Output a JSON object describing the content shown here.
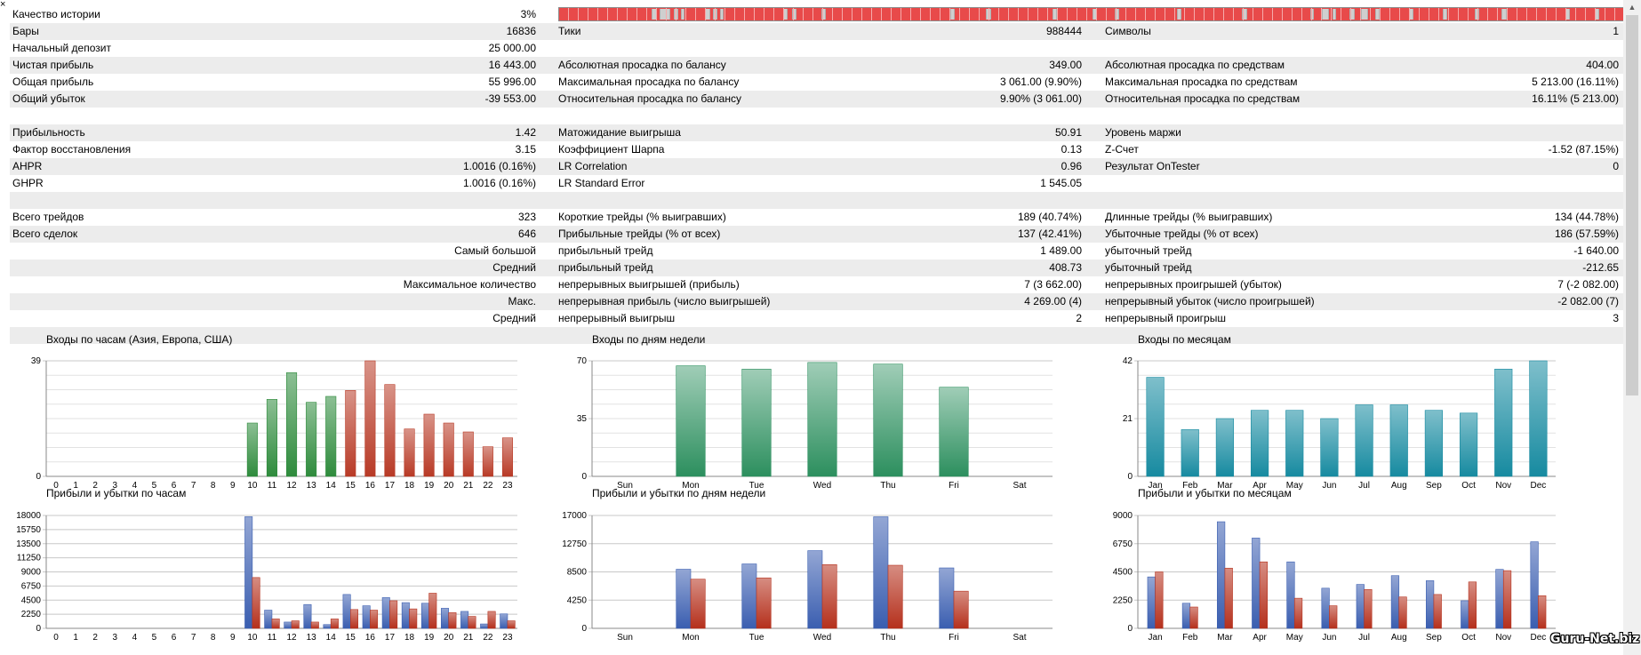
{
  "window": {
    "close_glyph": "×"
  },
  "history_quality": {
    "label": "Качество истории",
    "value": "3%"
  },
  "rows": [
    {
      "alt": true,
      "c1l": "Бары",
      "c1v": "16836",
      "c2l": "Тики",
      "c2v": "988444",
      "c3l": "Символы",
      "c3v": "1"
    },
    {
      "alt": false,
      "c1l": "Начальный депозит",
      "c1v": "25 000.00",
      "c2l": "",
      "c2v": "",
      "c3l": "",
      "c3v": ""
    },
    {
      "alt": true,
      "c1l": "Чистая прибыль",
      "c1v": "16 443.00",
      "c2l": "Абсолютная просадка по балансу",
      "c2v": "349.00",
      "c3l": "Абсолютная просадка по средствам",
      "c3v": "404.00"
    },
    {
      "alt": false,
      "c1l": "Общая прибыль",
      "c1v": "55 996.00",
      "c2l": "Максимальная просадка по балансу",
      "c2v": "3 061.00 (9.90%)",
      "c3l": "Максимальная просадка по средствам",
      "c3v": "5 213.00 (16.11%)"
    },
    {
      "alt": true,
      "c1l": "Общий убыток",
      "c1v": "-39 553.00",
      "c2l": "Относительная просадка по балансу",
      "c2v": "9.90% (3 061.00)",
      "c3l": "Относительная просадка по средствам",
      "c3v": "16.11% (5 213.00)"
    },
    {
      "alt": false,
      "c1l": "",
      "c1v": "",
      "c2l": "",
      "c2v": "",
      "c3l": "",
      "c3v": ""
    },
    {
      "alt": true,
      "c1l": "Прибыльность",
      "c1v": "1.42",
      "c2l": "Матожидание выигрыша",
      "c2v": "50.91",
      "c3l": "Уровень маржи",
      "c3v": ""
    },
    {
      "alt": false,
      "c1l": "Фактор восстановления",
      "c1v": "3.15",
      "c2l": "Коэффициент Шарпа",
      "c2v": "0.13",
      "c3l": "Z-Счет",
      "c3v": "-1.52 (87.15%)"
    },
    {
      "alt": true,
      "c1l": "AHPR",
      "c1v": "1.0016 (0.16%)",
      "c2l": "LR Correlation",
      "c2v": "0.96",
      "c3l": "Результат OnTester",
      "c3v": "0"
    },
    {
      "alt": false,
      "c1l": "GHPR",
      "c1v": "1.0016 (0.16%)",
      "c2l": "LR Standard Error",
      "c2v": "1 545.05",
      "c3l": "",
      "c3v": ""
    },
    {
      "alt": true,
      "c1l": "",
      "c1v": "",
      "c2l": "",
      "c2v": "",
      "c3l": "",
      "c3v": ""
    },
    {
      "alt": false,
      "c1l": "Всего трейдов",
      "c1v": "323",
      "c2l": "Короткие трейды (% выигравших)",
      "c2v": "189 (40.74%)",
      "c3l": "Длинные трейды (% выигравших)",
      "c3v": "134 (44.78%)"
    },
    {
      "alt": true,
      "c1l": "Всего сделок",
      "c1v": "646",
      "c2l": "Прибыльные трейды (% от всех)",
      "c2v": "137 (42.41%)",
      "c3l": "Убыточные трейды (% от всех)",
      "c3v": "186 (57.59%)"
    },
    {
      "alt": false,
      "c1r": "Самый большой",
      "c2l": "прибыльный трейд",
      "c2v": "1 489.00",
      "c3l": "убыточный трейд",
      "c3v": "-1 640.00"
    },
    {
      "alt": true,
      "c1r": "Средний",
      "c2l": "прибыльный трейд",
      "c2v": "408.73",
      "c3l": "убыточный трейд",
      "c3v": "-212.65"
    },
    {
      "alt": false,
      "c1r": "Максимальное количество",
      "c2l": "непрерывных выигрышей (прибыль)",
      "c2v": "7 (3 662.00)",
      "c3l": "непрерывных проигрышей (убыток)",
      "c3v": "7 (-2 082.00)"
    },
    {
      "alt": true,
      "c1r": "Макс.",
      "c2l": "непрерывная прибыль (число выигрышей)",
      "c2v": "4 269.00 (4)",
      "c3l": "непрерывный убыток (число проигрышей)",
      "c3v": "-2 082.00 (7)"
    },
    {
      "alt": false,
      "c1r": "Средний",
      "c2l": "непрерывный выигрыш",
      "c2v": "2",
      "c3l": "непрерывный проигрыш",
      "c3v": "3"
    },
    {
      "alt": true,
      "c1l": "",
      "c1v": "",
      "c2l": "",
      "c2v": "",
      "c3l": "",
      "c3v": ""
    }
  ],
  "colors": {
    "hours_green": "#2e8b3c",
    "hours_red": "#b83a26",
    "weekdays_green": "#2c8f5e",
    "months_teal": "#168aa0",
    "profit_blue": "#3a5eb0",
    "loss_red": "#b5301c",
    "grid": "#c8c8c8",
    "quality_red": "#e84a4a"
  },
  "watermark": "Guru-Net.biz",
  "chart_data": [
    {
      "id": "entries-hours",
      "type": "bar",
      "title": "Входы по часам (Азия, Европа, США)",
      "categories": [
        "0",
        "1",
        "2",
        "3",
        "4",
        "5",
        "6",
        "7",
        "8",
        "9",
        "10",
        "11",
        "12",
        "13",
        "14",
        "15",
        "16",
        "17",
        "18",
        "19",
        "20",
        "21",
        "22",
        "23"
      ],
      "values": [
        0,
        0,
        0,
        0,
        0,
        0,
        0,
        0,
        0,
        0,
        18,
        26,
        35,
        25,
        27,
        29,
        39,
        31,
        16,
        21,
        18,
        15,
        10,
        13
      ],
      "ylim": [
        0,
        39
      ],
      "yticks": [
        "0",
        "39"
      ],
      "grid": true
    },
    {
      "id": "entries-weekdays",
      "type": "bar",
      "title": "Входы по дням недели",
      "categories": [
        "Sun",
        "Mon",
        "Tue",
        "Wed",
        "Thu",
        "Fri",
        "Sat"
      ],
      "values": [
        0,
        67,
        65,
        69,
        68,
        54,
        0
      ],
      "ylim": [
        0,
        70
      ],
      "yticks": [
        "0",
        "35",
        "70"
      ],
      "grid": true
    },
    {
      "id": "entries-months",
      "type": "bar",
      "title": "Входы по месяцам",
      "categories": [
        "Jan",
        "Feb",
        "Mar",
        "Apr",
        "May",
        "Jun",
        "Jul",
        "Aug",
        "Sep",
        "Oct",
        "Nov",
        "Dec"
      ],
      "values": [
        36,
        17,
        21,
        24,
        24,
        21,
        26,
        26,
        24,
        23,
        39,
        42
      ],
      "ylim": [
        0,
        42
      ],
      "yticks": [
        "0",
        "21",
        "42"
      ],
      "grid": true
    },
    {
      "id": "pl-hours",
      "type": "bar",
      "title": "Прибыли и убытки по часам",
      "categories": [
        "0",
        "1",
        "2",
        "3",
        "4",
        "5",
        "6",
        "7",
        "8",
        "9",
        "10",
        "11",
        "12",
        "13",
        "14",
        "15",
        "16",
        "17",
        "18",
        "19",
        "20",
        "21",
        "22",
        "23"
      ],
      "series": [
        {
          "values": [
            0,
            0,
            0,
            0,
            0,
            0,
            0,
            0,
            0,
            0,
            17800,
            2900,
            1000,
            3800,
            600,
            5400,
            3600,
            4900,
            4100,
            4000,
            3200,
            2700,
            700,
            2300
          ]
        },
        {
          "values": [
            0,
            0,
            0,
            0,
            0,
            0,
            0,
            0,
            0,
            0,
            8100,
            1500,
            1200,
            1000,
            1500,
            3000,
            2900,
            4400,
            3100,
            5600,
            2500,
            1900,
            2700,
            1200
          ]
        }
      ],
      "ylim": [
        0,
        18000
      ],
      "yticks": [
        "0",
        "2250",
        "4500",
        "6750",
        "9000",
        "11250",
        "13500",
        "15750",
        "18000"
      ],
      "grid": true
    },
    {
      "id": "pl-weekdays",
      "type": "bar",
      "title": "Прибыли и убытки по дням недели",
      "categories": [
        "Sun",
        "Mon",
        "Tue",
        "Wed",
        "Thu",
        "Fri",
        "Sat"
      ],
      "series": [
        {
          "values": [
            0,
            8900,
            9700,
            11700,
            16800,
            9100,
            0
          ]
        },
        {
          "values": [
            0,
            7400,
            7600,
            9600,
            9500,
            5600,
            0
          ]
        }
      ],
      "ylim": [
        0,
        17000
      ],
      "yticks": [
        "0",
        "4250",
        "8500",
        "12750",
        "17000"
      ],
      "grid": true
    },
    {
      "id": "pl-months",
      "type": "bar",
      "title": "Прибыли и убытки по месяцам",
      "categories": [
        "Jan",
        "Feb",
        "Mar",
        "Apr",
        "May",
        "Jun",
        "Jul",
        "Aug",
        "Sep",
        "Oct",
        "Nov",
        "Dec"
      ],
      "series": [
        {
          "values": [
            4100,
            2000,
            8500,
            7200,
            5300,
            3200,
            3500,
            4200,
            3800,
            2200,
            4700,
            6900
          ]
        },
        {
          "values": [
            4500,
            1700,
            4800,
            5300,
            2400,
            1800,
            3100,
            2500,
            2700,
            3700,
            4600,
            2600
          ]
        }
      ],
      "ylim": [
        0,
        9000
      ],
      "yticks": [
        "0",
        "2250",
        "4500",
        "6750",
        "9000"
      ],
      "grid": true
    }
  ]
}
